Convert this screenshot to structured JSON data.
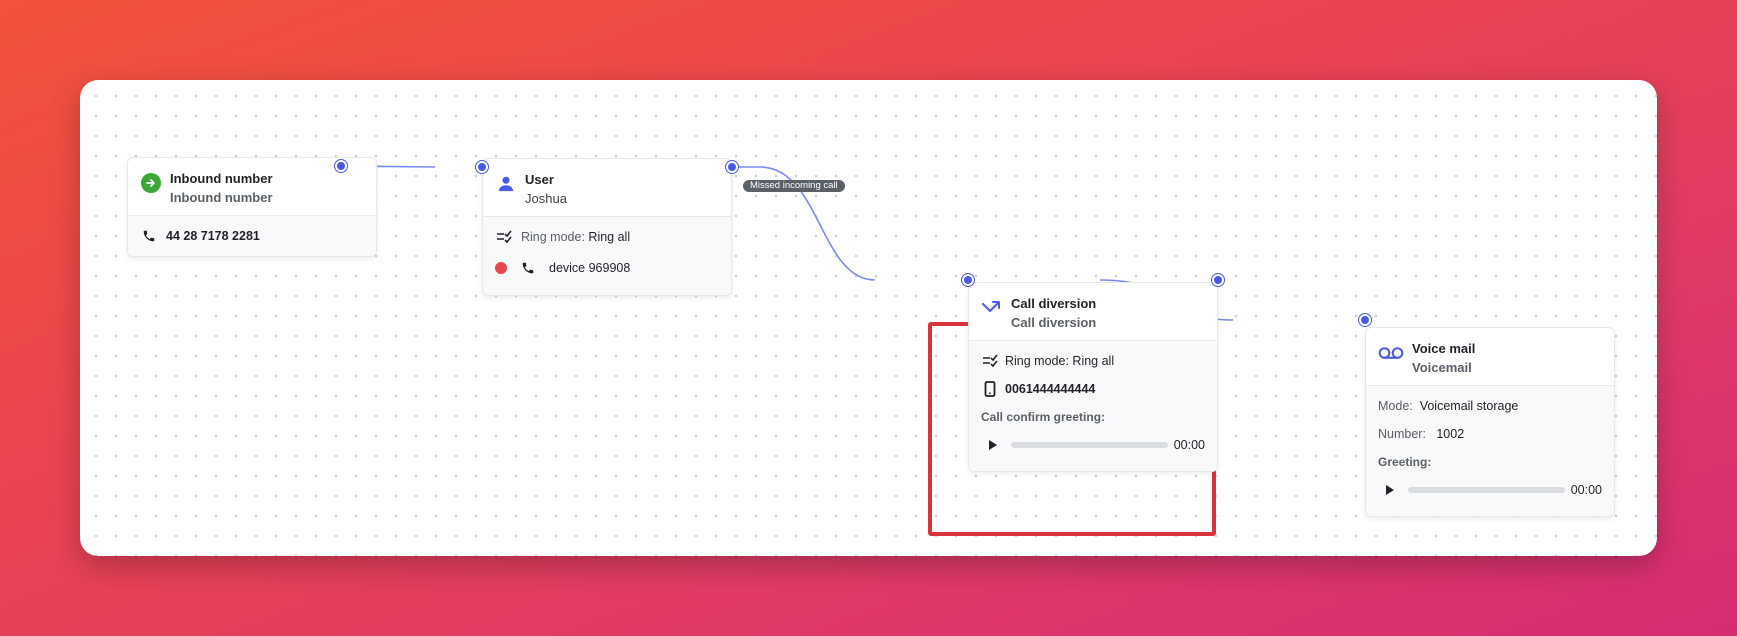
{
  "nodes": {
    "inbound": {
      "title": "Inbound number",
      "subtitle": "Inbound number",
      "phone_number": "44 28 7178 2281"
    },
    "user": {
      "title": "User",
      "subtitle": "Joshua",
      "ring_mode_label": "Ring mode:",
      "ring_mode_value": "Ring all",
      "device": "device 969908",
      "device_status_color": "#e5484d"
    },
    "call_diversion": {
      "title": "Call diversion",
      "subtitle": "Call diversion",
      "ring_mode_label": "Ring mode:",
      "ring_mode_value": "Ring all",
      "number": "0061444444444",
      "greeting_label": "Call confirm greeting:",
      "time": "00:00"
    },
    "voicemail": {
      "title": "Voice mail",
      "subtitle": "Voicemail",
      "mode_label": "Mode:",
      "mode_value": "Voicemail storage",
      "number_label": "Number:",
      "number_value": "1002",
      "greeting_label": "Greeting:",
      "time": "00:00"
    }
  },
  "edges": {
    "missed_label": "Missed incoming call"
  },
  "colors": {
    "accent": "#4a5ae8",
    "inbound_icon": "#3aaa35",
    "selection": "#d9343e"
  },
  "icons": {
    "inbound": "arrow-right-circle-icon",
    "user": "person-icon",
    "call_diversion": "call-forward-icon",
    "voicemail": "voicemail-icon",
    "phone": "phone-icon",
    "mobile": "mobile-phone-icon",
    "ring_mode": "ring-mode-list-icon",
    "play": "play-icon"
  }
}
